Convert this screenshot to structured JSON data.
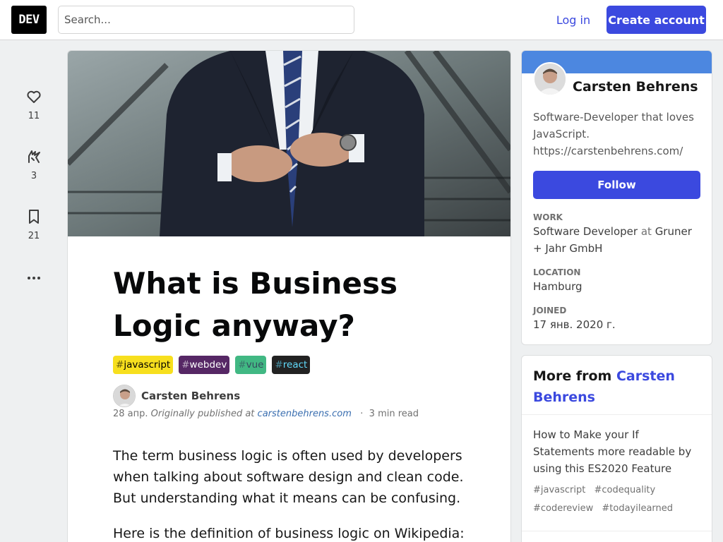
{
  "header": {
    "logo": "DEV",
    "search_placeholder": "Search...",
    "login_label": "Log in",
    "create_label": "Create account",
    "accent": "#3b49df"
  },
  "reactions": {
    "hearts": "11",
    "unicorns": "3",
    "bookmarks": "21",
    "more_icon": "ellipsis-icon"
  },
  "article": {
    "title_line1": "What is Business",
    "title_line2": "Logic anyway?",
    "tags": [
      {
        "name": "javascript",
        "bg": "#f7df1e",
        "fg": "#000000"
      },
      {
        "name": "webdev",
        "bg": "#562765",
        "fg": "#ffffff"
      },
      {
        "name": "vue",
        "bg": "#41b883",
        "fg": "#35495e"
      },
      {
        "name": "react",
        "bg": "#222222",
        "fg": "#61dafb"
      }
    ],
    "author": "Carsten Behrens",
    "date": "28 апр.",
    "originally": "Originally published at",
    "source": "carstenbehrens.com",
    "read_time": "3 min read",
    "para1": "The term business logic is often used by developers when talking about software design and clean code. But understanding what it means can be confusing.",
    "para2": "Here is the definition of business logic on Wikipedia:"
  },
  "profile": {
    "name": "Carsten Behrens",
    "bio_line1": "Software-Developer that loves JavaScript.",
    "bio_url": "https://carstenbehrens.com/",
    "follow_label": "Follow",
    "work_label": "Work",
    "work_role": "Software Developer",
    "work_at": "at",
    "work_company": "Gruner + Jahr GmbH",
    "location_label": "Location",
    "location": "Hamburg",
    "joined_label": "Joined",
    "joined": "17 янв. 2020 г.",
    "brand_color": "#4c87e0"
  },
  "more_from": {
    "prefix": "More from",
    "author": "Carsten Behrens",
    "item_title": "How to Make your If Statements more readable by using this ES2020 Feature",
    "item_tags": [
      "#javascript",
      "#codequality",
      "#codereview",
      "#todayilearned"
    ]
  }
}
